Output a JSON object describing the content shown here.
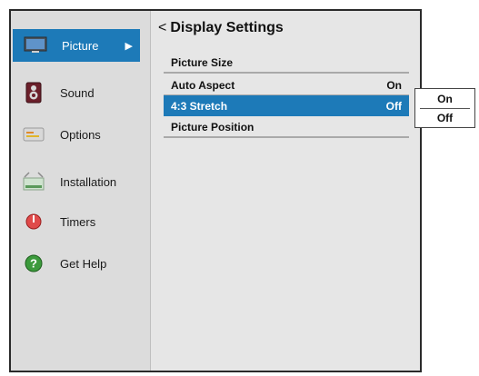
{
  "sidebar": {
    "items": [
      {
        "label": "Picture",
        "icon": "monitor-icon",
        "active": true
      },
      {
        "label": "Sound",
        "icon": "speaker-icon",
        "active": false
      },
      {
        "label": "Options",
        "icon": "options-icon",
        "active": false
      },
      {
        "label": "Installation",
        "icon": "installation-icon",
        "active": false
      },
      {
        "label": "Timers",
        "icon": "timer-icon",
        "active": false
      },
      {
        "label": "Get Help",
        "icon": "help-icon",
        "active": false
      }
    ],
    "active_arrow": "▶"
  },
  "panel": {
    "back_symbol": "<",
    "title": "Display Settings",
    "rows": [
      {
        "label": "Picture Size",
        "value": ""
      },
      {
        "label": "Auto Aspect",
        "value": "On"
      },
      {
        "label": "4:3 Stretch",
        "value": "Off",
        "selected": true
      },
      {
        "label": "Picture Position",
        "value": ""
      }
    ]
  },
  "popup": {
    "options": [
      "On",
      "Off"
    ]
  },
  "colors": {
    "accent": "#1d7ab8",
    "panel_bg": "#e6e6e6",
    "sidebar_bg": "#dcdcdc"
  }
}
